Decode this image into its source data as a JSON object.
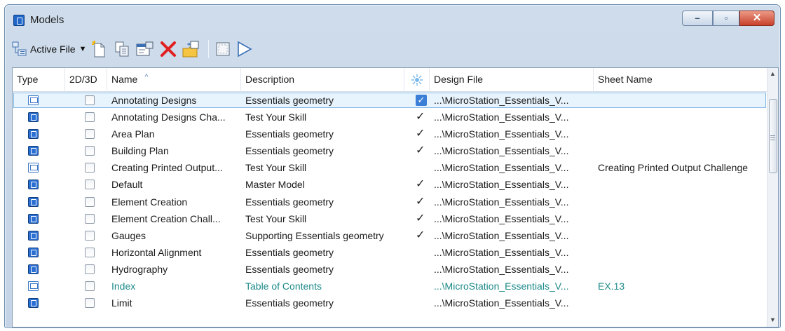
{
  "window": {
    "title": "Models"
  },
  "title_buttons": {
    "minimize": "–",
    "restore": "▫",
    "close": "✕"
  },
  "toolbar": {
    "source_label": "Active File",
    "icons": [
      "models-source-icon",
      "new-model-icon",
      "copy-model-icon",
      "model-properties-icon",
      "delete-model-icon",
      "import-model-icon",
      "level-icon",
      "cursor-icon"
    ]
  },
  "columns": {
    "type": "Type",
    "dim": "2D/3D",
    "name": "Name",
    "description": "Description",
    "design_file": "Design File",
    "sheet_name": "Sheet Name"
  },
  "colors": {
    "link_text": "#1e8a8a",
    "selection_border": "#7fb6e6",
    "model_icon": "#2a6fd1"
  },
  "rows": [
    {
      "type_icon": "sheet-model-icon",
      "name": "Annotating Designs",
      "description": "Essentials geometry",
      "check": "✓",
      "check_style": "boxed",
      "design_file": "...\\MicroStation_Essentials_V...",
      "sheet_name": "",
      "selected": true
    },
    {
      "type_icon": "design-model-icon",
      "name": "Annotating Designs Cha...",
      "description": "Test Your Skill",
      "check": "✓",
      "design_file": "...\\MicroStation_Essentials_V...",
      "sheet_name": ""
    },
    {
      "type_icon": "design-model-icon",
      "name": "Area Plan",
      "description": "Essentials geometry",
      "check": "✓",
      "design_file": "...\\MicroStation_Essentials_V...",
      "sheet_name": ""
    },
    {
      "type_icon": "design-model-icon",
      "name": "Building Plan",
      "description": "Essentials geometry",
      "check": "✓",
      "design_file": "...\\MicroStation_Essentials_V...",
      "sheet_name": ""
    },
    {
      "type_icon": "sheet-model-icon",
      "name": "Creating Printed Output...",
      "description": "Test Your Skill",
      "check": "",
      "design_file": "...\\MicroStation_Essentials_V...",
      "sheet_name": "Creating Printed Output Challenge"
    },
    {
      "type_icon": "design-model-icon",
      "name": "Default",
      "description": "Master Model",
      "check": "✓",
      "design_file": "...\\MicroStation_Essentials_V...",
      "sheet_name": ""
    },
    {
      "type_icon": "design-model-icon",
      "name": "Element Creation",
      "description": "Essentials geometry",
      "check": "✓",
      "design_file": "...\\MicroStation_Essentials_V...",
      "sheet_name": ""
    },
    {
      "type_icon": "design-model-icon",
      "name": "Element Creation Chall...",
      "description": "Test Your Skill",
      "check": "✓",
      "design_file": "...\\MicroStation_Essentials_V...",
      "sheet_name": ""
    },
    {
      "type_icon": "design-model-icon",
      "name": "Gauges",
      "description": "Supporting Essentials geometry",
      "check": "✓",
      "design_file": "...\\MicroStation_Essentials_V...",
      "sheet_name": ""
    },
    {
      "type_icon": "design-model-icon",
      "name": "Horizontal Alignment",
      "description": "Essentials geometry",
      "check": "",
      "design_file": "...\\MicroStation_Essentials_V...",
      "sheet_name": ""
    },
    {
      "type_icon": "design-model-icon",
      "name": "Hydrography",
      "description": "Essentials geometry",
      "check": "",
      "design_file": "...\\MicroStation_Essentials_V...",
      "sheet_name": ""
    },
    {
      "type_icon": "sheet-model-icon",
      "name": "Index",
      "description": "Table of Contents",
      "check": "",
      "design_file": "...\\MicroStation_Essentials_V...",
      "sheet_name": "EX.13",
      "link": true
    },
    {
      "type_icon": "design-model-icon",
      "name": "Limit",
      "description": "Essentials geometry",
      "check": "",
      "design_file": "...\\MicroStation_Essentials_V...",
      "sheet_name": ""
    }
  ],
  "scrollbar": {
    "up": "▲",
    "down": "▼"
  }
}
